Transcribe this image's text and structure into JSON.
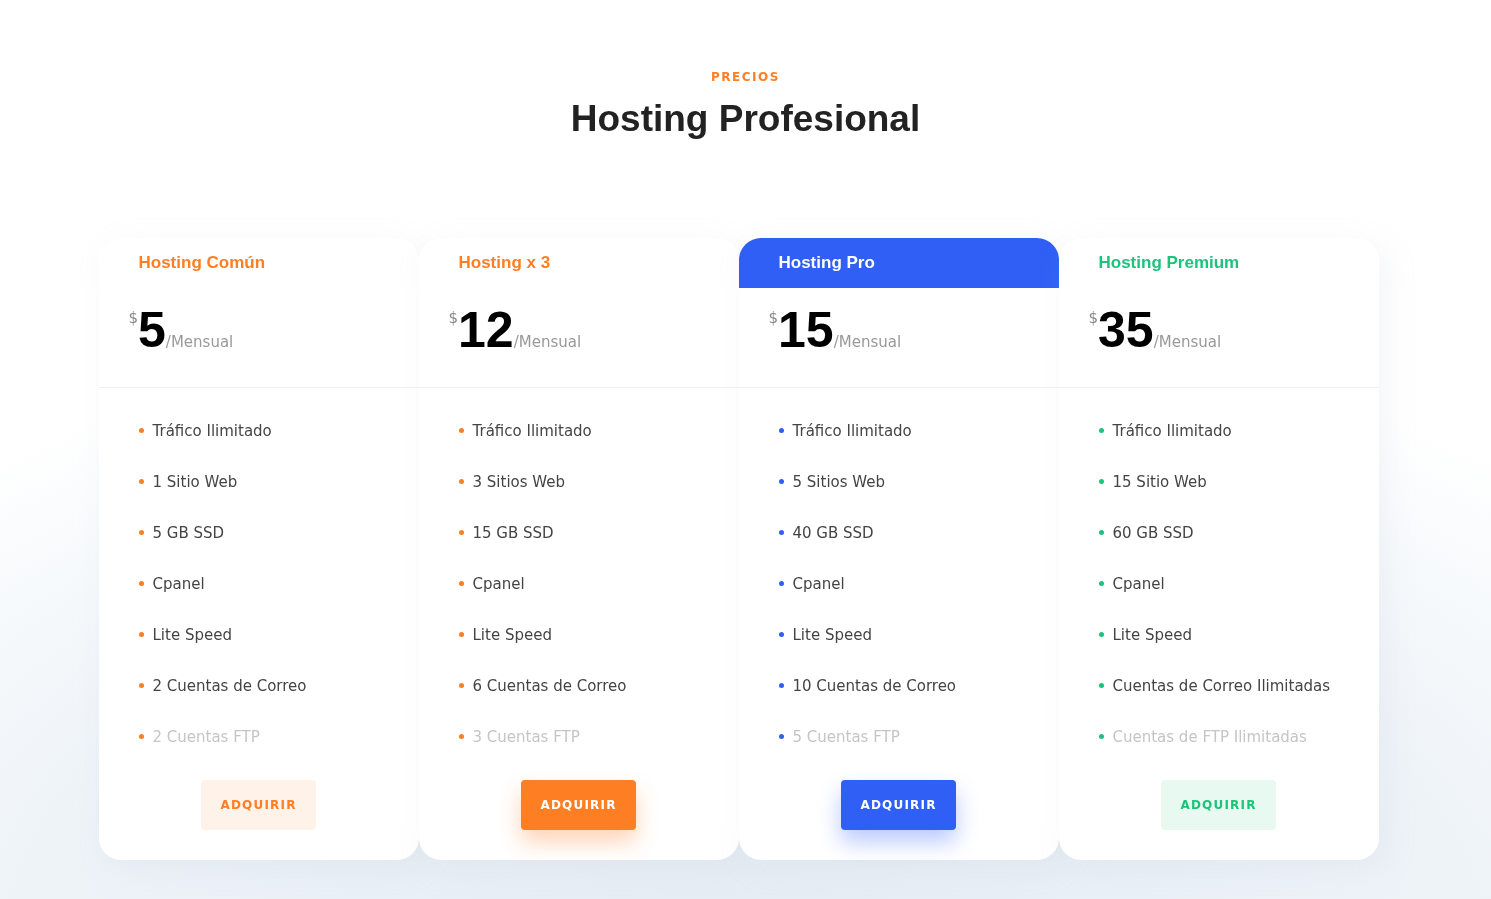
{
  "section": {
    "eyebrow": "PRECIOS",
    "title": "Hosting Profesional"
  },
  "plans": [
    {
      "name": "Hosting Común",
      "color": "#fd7e23",
      "featured": false,
      "currency": "$",
      "price": "5",
      "period": "/Mensual",
      "features": [
        {
          "text": "Tráfico Ilimitado",
          "disabled": false
        },
        {
          "text": "1 Sitio Web",
          "disabled": false
        },
        {
          "text": "5 GB SSD",
          "disabled": false
        },
        {
          "text": "Cpanel",
          "disabled": false
        },
        {
          "text": "Lite Speed",
          "disabled": false
        },
        {
          "text": "2 Cuentas de Correo",
          "disabled": false
        },
        {
          "text": "2 Cuentas FTP",
          "disabled": true
        }
      ],
      "button": {
        "label": "ADQUIRIR",
        "kind": "soft"
      }
    },
    {
      "name": "Hosting x 3",
      "color": "#fd7e23",
      "featured": false,
      "currency": "$",
      "price": "12",
      "period": "/Mensual",
      "features": [
        {
          "text": "Tráfico Ilimitado",
          "disabled": false
        },
        {
          "text": "3 Sitios Web",
          "disabled": false
        },
        {
          "text": "15 GB SSD",
          "disabled": false
        },
        {
          "text": "Cpanel",
          "disabled": false
        },
        {
          "text": "Lite Speed",
          "disabled": false
        },
        {
          "text": "6 Cuentas de Correo",
          "disabled": false
        },
        {
          "text": "3 Cuentas FTP",
          "disabled": true
        }
      ],
      "button": {
        "label": "ADQUIRIR",
        "kind": "solid"
      }
    },
    {
      "name": "Hosting Pro",
      "color": "#2f5ff5",
      "featured": true,
      "currency": "$",
      "price": "15",
      "period": "/Mensual",
      "features": [
        {
          "text": "Tráfico Ilimitado",
          "disabled": false
        },
        {
          "text": "5 Sitios Web",
          "disabled": false
        },
        {
          "text": "40 GB SSD",
          "disabled": false
        },
        {
          "text": "Cpanel",
          "disabled": false
        },
        {
          "text": "Lite Speed",
          "disabled": false
        },
        {
          "text": "10 Cuentas de Correo",
          "disabled": false
        },
        {
          "text": "5 Cuentas FTP",
          "disabled": true
        }
      ],
      "button": {
        "label": "ADQUIRIR",
        "kind": "solid"
      }
    },
    {
      "name": "Hosting Premium",
      "color": "#1dc37a",
      "featured": false,
      "currency": "$",
      "price": "35",
      "period": "/Mensual",
      "features": [
        {
          "text": "Tráfico Ilimitado",
          "disabled": false
        },
        {
          "text": "15 Sitio Web",
          "disabled": false
        },
        {
          "text": "60 GB SSD",
          "disabled": false
        },
        {
          "text": "Cpanel",
          "disabled": false
        },
        {
          "text": "Lite Speed",
          "disabled": false
        },
        {
          "text": "Cuentas de Correo Ilimitadas",
          "disabled": false
        },
        {
          "text": "Cuentas de FTP Ilimitadas",
          "disabled": true
        }
      ],
      "button": {
        "label": "ADQUIRIR",
        "kind": "soft"
      }
    }
  ]
}
